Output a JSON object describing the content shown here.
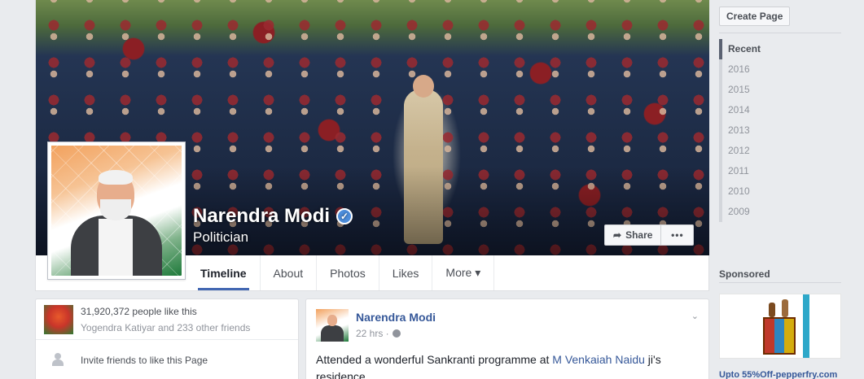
{
  "page": {
    "name": "Narendra Modi",
    "category": "Politician"
  },
  "cover_actions": {
    "share_label": "Share",
    "more_label": "•••"
  },
  "tabs": [
    {
      "label": "Timeline"
    },
    {
      "label": "About"
    },
    {
      "label": "Photos"
    },
    {
      "label": "Likes"
    },
    {
      "label": "More ▾"
    }
  ],
  "sidebar": {
    "create_page_label": "Create Page",
    "years": [
      "Recent",
      "2016",
      "2015",
      "2014",
      "2013",
      "2012",
      "2011",
      "2010",
      "2009"
    ],
    "sponsored_label": "Sponsored",
    "ad_title": "Upto 55%Off-pepperfry.com"
  },
  "likes_box": {
    "count_text": "31,920,372 people like this",
    "friends_text": "Yogendra Katiyar and 233 other friends",
    "invite_text": "Invite friends to like this Page"
  },
  "post": {
    "author": "Narendra Modi",
    "time": "22 hrs ·",
    "chevron": "⌄",
    "text_before": "Attended a wonderful Sankranti programme at ",
    "link": "M Venkaiah Naidu",
    "text_after": " ji's residence."
  },
  "icons": {
    "verified": "verified-badge-icon",
    "share": "share-arrow-icon",
    "globe": "globe-icon",
    "person": "person-icon"
  },
  "colors": {
    "link": "#365899",
    "verified": "#4d8ddb",
    "tab_underline": "#4267b2"
  }
}
